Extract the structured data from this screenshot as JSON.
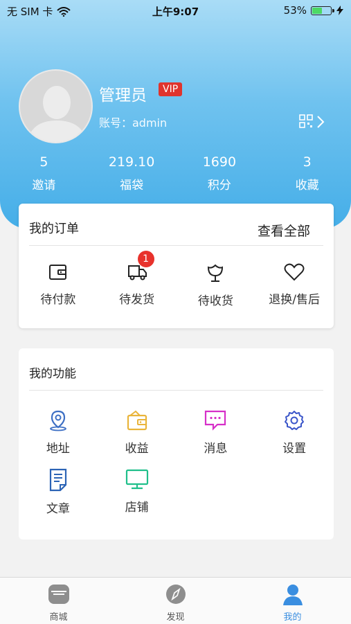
{
  "status_bar": {
    "carrier": "无 SIM 卡",
    "time": "上午9:07",
    "battery": "53%"
  },
  "profile": {
    "name": "管理员",
    "vip_badge": "VIP",
    "account": "账号：admin"
  },
  "stats": [
    {
      "value": "5",
      "label": "邀请"
    },
    {
      "value": "219.10",
      "label": "福袋"
    },
    {
      "value": "1690",
      "label": "积分"
    },
    {
      "value": "3",
      "label": "收藏"
    }
  ],
  "orders": {
    "title": "我的订单",
    "view_all": "查看全部",
    "items": [
      {
        "label": "待付款",
        "icon": "wallet-icon"
      },
      {
        "label": "待发货",
        "icon": "truck-icon",
        "badge": "1"
      },
      {
        "label": "待收货",
        "icon": "flower-icon"
      },
      {
        "label": "退换/售后",
        "icon": "heart-icon"
      }
    ]
  },
  "functions": {
    "title": "我的功能",
    "items": [
      {
        "label": "地址",
        "icon": "location-icon",
        "color": "#3d6fc4"
      },
      {
        "label": "收益",
        "icon": "wallet-icon",
        "color": "#e9b43a"
      },
      {
        "label": "消息",
        "icon": "message-icon",
        "color": "#d62fc8"
      },
      {
        "label": "设置",
        "icon": "gear-icon",
        "color": "#3a55c9"
      },
      {
        "label": "文章",
        "icon": "document-icon",
        "color": "#2b63b5"
      },
      {
        "label": "店铺",
        "icon": "monitor-icon",
        "color": "#1fbf8a"
      }
    ]
  },
  "tabbar": {
    "items": [
      {
        "label": "商城",
        "icon": "store-icon"
      },
      {
        "label": "发现",
        "icon": "compass-icon"
      },
      {
        "label": "我的",
        "icon": "user-icon",
        "active": true
      }
    ],
    "active_color": "#3a8ee0"
  }
}
